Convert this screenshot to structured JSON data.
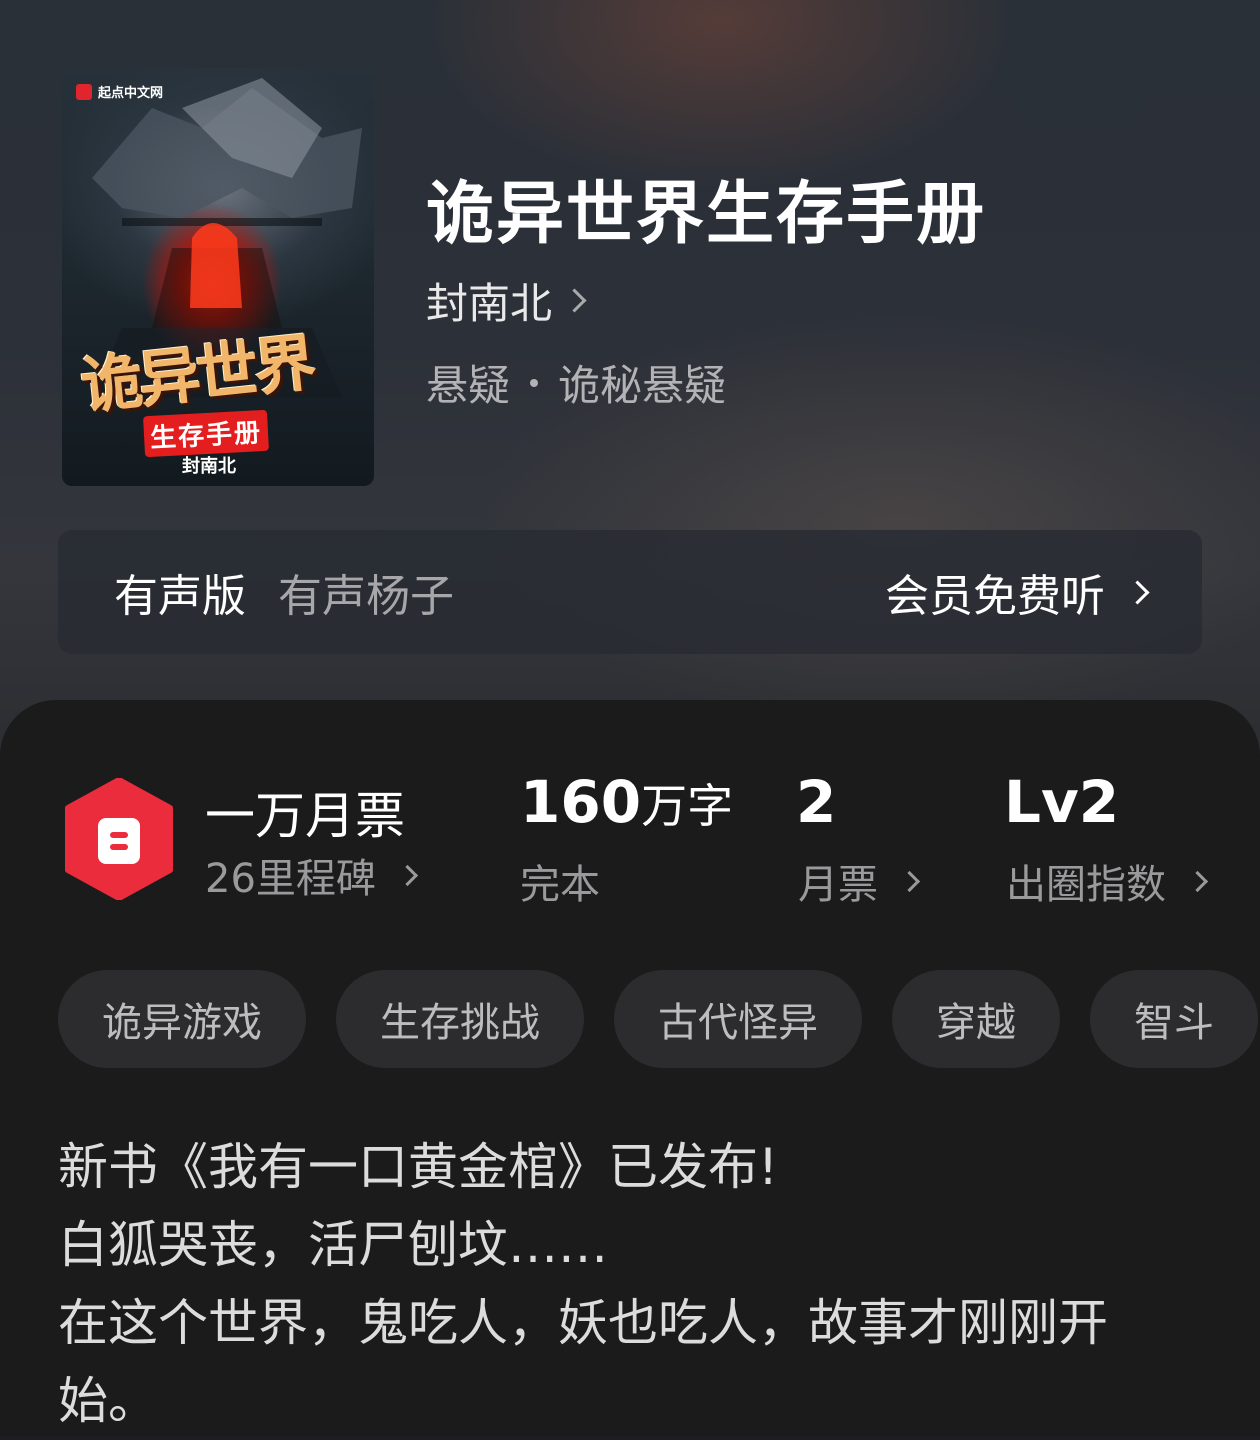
{
  "book": {
    "title": "诡异世界生存手册",
    "author": "封南北",
    "genre_main": "悬疑",
    "genre_sub": "诡秘悬疑"
  },
  "cover": {
    "publisher": "起点中文网",
    "title_art": "诡异世界",
    "subtitle_art": "生存手册",
    "author_art": "封南北"
  },
  "audio": {
    "label": "有声版",
    "narrator": "有声杨子",
    "cta": "会员免费听"
  },
  "stats": {
    "monthly_ticket_title": "一万月票",
    "milestones": "26里程碑",
    "word_count": "160",
    "word_unit": "万字",
    "status": "完本",
    "ticket_count": "2",
    "ticket_label": "月票",
    "level": "Lv2",
    "level_label": "出圈指数"
  },
  "tags": [
    "诡异游戏",
    "生存挑战",
    "古代怪异",
    "穿越",
    "智斗"
  ],
  "intro": [
    "新书《我有一口黄金棺》已发布!",
    "白狐哭丧，活尸刨坟……",
    "在这个世界，鬼吃人，妖也吃人，故事才刚刚开",
    "始。"
  ],
  "colors": {
    "accent_red": "#ea2c3c",
    "panel_bg": "#1b1b1c",
    "tag_bg": "#2c2c2e"
  },
  "icons": {
    "badge": "ticket-hexagon-icon",
    "chevron": "chevron-right-icon"
  }
}
